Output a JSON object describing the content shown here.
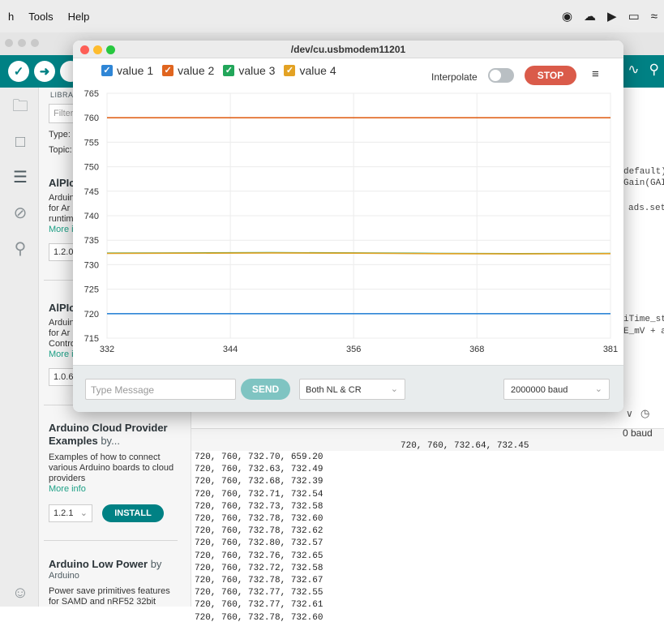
{
  "menubar": {
    "items": [
      "h",
      "Tools",
      "Help"
    ]
  },
  "library": {
    "header": "LIBRAR",
    "filter_placeholder": "Filter",
    "type_label": "Type:",
    "topic_label": "Topic:",
    "entries": [
      {
        "title": "AlPIc",
        "lines": [
          "Arduin",
          "for Ar",
          "runtim"
        ],
        "more": "More i",
        "version": "1.2.0"
      },
      {
        "title": "AlPIc",
        "lines": [
          "Arduin",
          "for Ar",
          "Contro"
        ],
        "more": "More i",
        "version": "1.0.6"
      },
      {
        "title": "Arduino Cloud Provider Examples",
        "by": "by...",
        "desc": "Examples of how to connect various Arduino boards to cloud providers",
        "more": "More info",
        "version": "1.2.1",
        "install": "INSTALL"
      },
      {
        "title": "Arduino Low Power",
        "by": "by",
        "author": "Arduino",
        "desc": "Power save primitives features for SAMD and nRF52 32bit"
      }
    ]
  },
  "editor": {
    "code_fragments": [
      "default)",
      "Gain(GAI",
      "ads.set",
      "iTime_st",
      "E_mV + a"
    ]
  },
  "monitor": {
    "ending_fragment": "∨",
    "baud_fragment": "0 baud",
    "first_line": "720, 760, 732.64, 732.45",
    "lines": [
      "720, 760, 732.70, 659.20",
      "720, 760, 732.63, 732.49",
      "720, 760, 732.68, 732.39",
      "720, 760, 732.71, 732.54",
      "720, 760, 732.73, 732.58",
      "720, 760, 732.78, 732.60",
      "720, 760, 732.78, 732.62",
      "720, 760, 732.80, 732.57",
      "720, 760, 732.76, 732.65",
      "720, 760, 732.72, 732.58",
      "720, 760, 732.78, 732.67",
      "720, 760, 732.77, 732.55",
      "720, 760, 732.77, 732.61",
      "720, 760, 732.78, 732.60"
    ]
  },
  "plotter": {
    "title": "/dev/cu.usbmodem11201",
    "interpolate_label": "Interpolate",
    "interpolate_on": false,
    "stop_label": "STOP",
    "message_placeholder": "Type Message",
    "send_label": "SEND",
    "line_ending": "Both NL & CR",
    "baud": "2000000 baud"
  },
  "colors": {
    "accent": "#008184",
    "stop": "#da5b4a",
    "value1": "#2f86d6",
    "value2": "#e0651f",
    "value3": "#22a65a",
    "value4": "#e3a224"
  },
  "chart_data": {
    "type": "line",
    "x_ticks": [
      332,
      344,
      356,
      368,
      381
    ],
    "y_ticks": [
      715,
      720,
      725,
      730,
      735,
      740,
      745,
      750,
      755,
      760,
      765
    ],
    "xlim": [
      332,
      381
    ],
    "ylim": [
      715,
      765
    ],
    "grid": true,
    "series": [
      {
        "name": "value 1",
        "color": "#2f86d6",
        "x": [
          332,
          381
        ],
        "y": [
          720,
          720
        ]
      },
      {
        "name": "value 2",
        "color": "#e0651f",
        "x": [
          332,
          381
        ],
        "y": [
          760,
          760
        ]
      },
      {
        "name": "value 3",
        "color": "#22a65a",
        "x": [
          332,
          340,
          348,
          356,
          364,
          372,
          381
        ],
        "y": [
          732.35,
          732.4,
          732.45,
          732.4,
          732.3,
          732.25,
          732.3
        ]
      },
      {
        "name": "value 4",
        "color": "#e3a224",
        "x": [
          332,
          340,
          348,
          356,
          364,
          372,
          381
        ],
        "y": [
          732.3,
          732.35,
          732.4,
          732.35,
          732.25,
          732.2,
          732.25
        ]
      }
    ]
  }
}
